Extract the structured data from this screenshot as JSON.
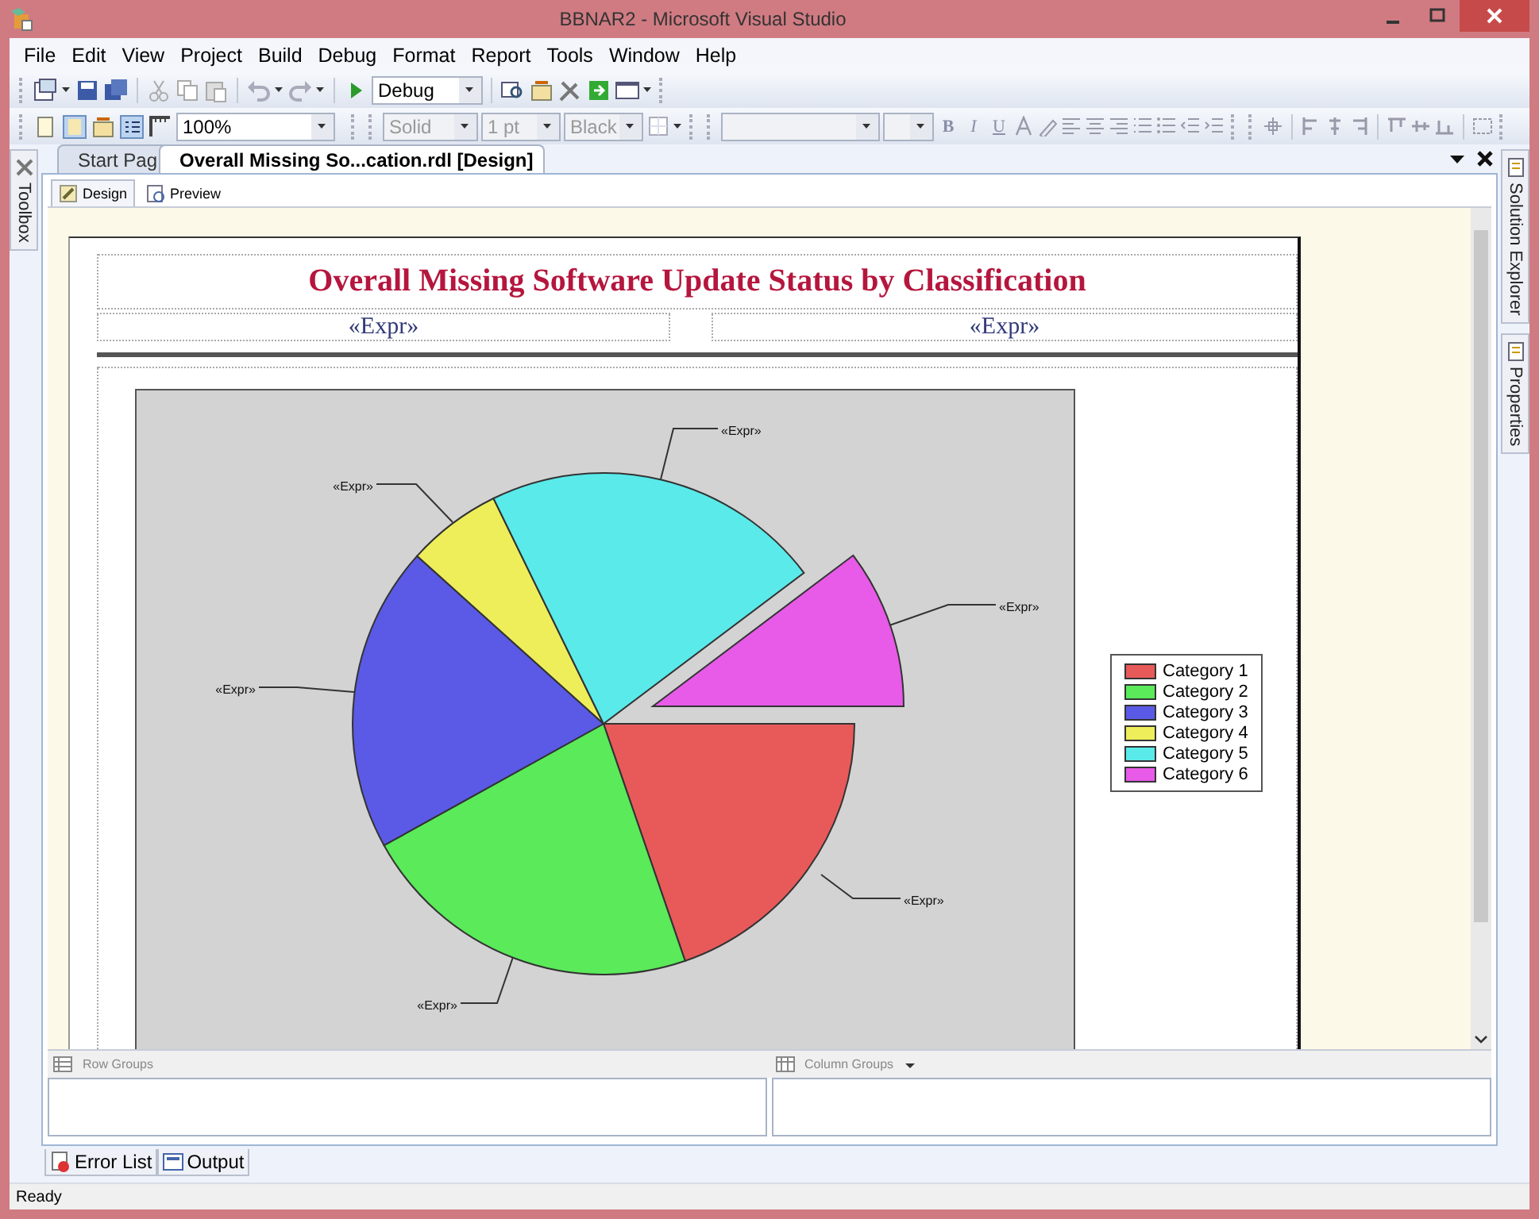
{
  "window": {
    "title": "BBNAR2 - Microsoft Visual Studio"
  },
  "menu": [
    "File",
    "Edit",
    "View",
    "Project",
    "Build",
    "Debug",
    "Format",
    "Report",
    "Tools",
    "Window",
    "Help"
  ],
  "toolbar_standard": {
    "configuration": "Debug"
  },
  "toolbar_report": {
    "combos": [
      {
        "value": "100%",
        "disabled": false
      },
      {
        "value": "Solid",
        "disabled": true
      },
      {
        "value": "1 pt",
        "disabled": true
      },
      {
        "value": "Black",
        "disabled": true
      }
    ],
    "format_buttons": [
      {
        "label": "B",
        "disabled": true
      },
      {
        "label": "I",
        "disabled": true
      },
      {
        "label": "U",
        "disabled": true
      }
    ]
  },
  "side_left": [
    "Toolbox"
  ],
  "side_right": [
    "Solution Explorer",
    "Properties"
  ],
  "doc_tabs": [
    {
      "label": "Start Pag",
      "selected": false
    },
    {
      "label": "Overall Missing So...cation.rdl [Design]",
      "selected": true
    }
  ],
  "view_tabs": [
    {
      "label": "Design",
      "selected": true
    },
    {
      "label": "Preview",
      "selected": false
    }
  ],
  "report": {
    "title": "Overall Missing Software Update Status by Classification",
    "header_fields": [
      "«Expr»",
      "«Expr»"
    ],
    "chart": {
      "series": [
        {
          "name": "Category 1",
          "color": "#e85a5a",
          "label": "«Expr»"
        },
        {
          "name": "Category 2",
          "color": "#5aea5a",
          "label": "«Expr»"
        },
        {
          "name": "Category 3",
          "color": "#5a5ae6",
          "label": "«Expr»"
        },
        {
          "name": "Category 4",
          "color": "#eeee5a",
          "label": "«Expr»"
        },
        {
          "name": "Category 5",
          "color": "#5aeaea",
          "label": "«Expr»"
        },
        {
          "name": "Category 6",
          "color": "#e85ae8",
          "label": "«Expr»"
        }
      ]
    }
  },
  "groups": {
    "row": "Row Groups",
    "column": "Column Groups"
  },
  "bottom_tabs": [
    "Error List",
    "Output"
  ],
  "status_bar": {
    "text": "Ready"
  }
}
